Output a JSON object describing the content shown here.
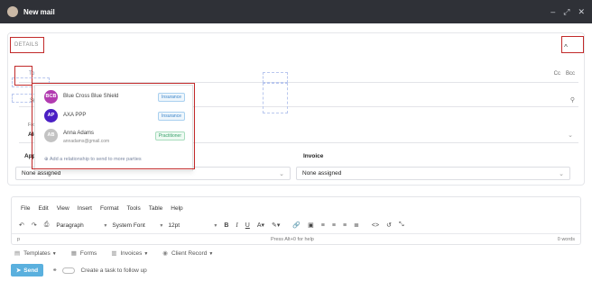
{
  "window": {
    "title": "New mail",
    "controls": [
      "minimize-icon",
      "expand-icon",
      "close-icon"
    ]
  },
  "details": {
    "label": "DETAILS",
    "collapse_icon": "chevron-up-icon"
  },
  "to": {
    "label": "To",
    "cc": "Cc",
    "bcc": "Bcc"
  },
  "subject": {
    "label": "Sub",
    "attach_icon": "paperclip-icon"
  },
  "from": {
    "label": "From",
    "value": "Ale"
  },
  "appointment": {
    "label": "Appo",
    "value": "None assigned"
  },
  "invoice": {
    "label": "Invoice",
    "value": "None assigned"
  },
  "recipients_dropdown": {
    "items": [
      {
        "initials": "BCB",
        "name": "Blue Cross Blue Shield",
        "email": "",
        "badge": "Insurance",
        "avatar_color": "#b23bb0"
      },
      {
        "initials": "AP",
        "name": "AXA PPP",
        "email": "",
        "badge": "Insurance",
        "avatar_color": "#4a1fc4"
      },
      {
        "initials": "AB",
        "name": "Anna Adams",
        "email": "annadams@gmail.com",
        "badge": "Practitioner",
        "avatar_color": "#c3c3c3"
      }
    ],
    "add_relationship": "Add a relationship to send to more parties"
  },
  "editor": {
    "menu": [
      "File",
      "Edit",
      "View",
      "Insert",
      "Format",
      "Tools",
      "Table",
      "Help"
    ],
    "toolbar": {
      "paragraph": "Paragraph",
      "font": "System Font",
      "size": "12pt"
    },
    "status": {
      "path": "p",
      "help": "Press Alt+0 for help",
      "words": "0 words"
    }
  },
  "bottom_links": [
    {
      "icon": "document-icon",
      "label": "Templates",
      "has_caret": true
    },
    {
      "icon": "form-icon",
      "label": "Forms",
      "has_caret": false
    },
    {
      "icon": "invoice-icon",
      "label": "Invoices",
      "has_caret": true
    },
    {
      "icon": "client-record-icon",
      "label": "Client Record",
      "has_caret": true
    }
  ],
  "actions": {
    "send": "Send",
    "task": "Create a task to follow up"
  },
  "colors": {
    "titlebar": "#2f3137",
    "highlight": "#c22a2a",
    "send": "#5ab0de"
  }
}
